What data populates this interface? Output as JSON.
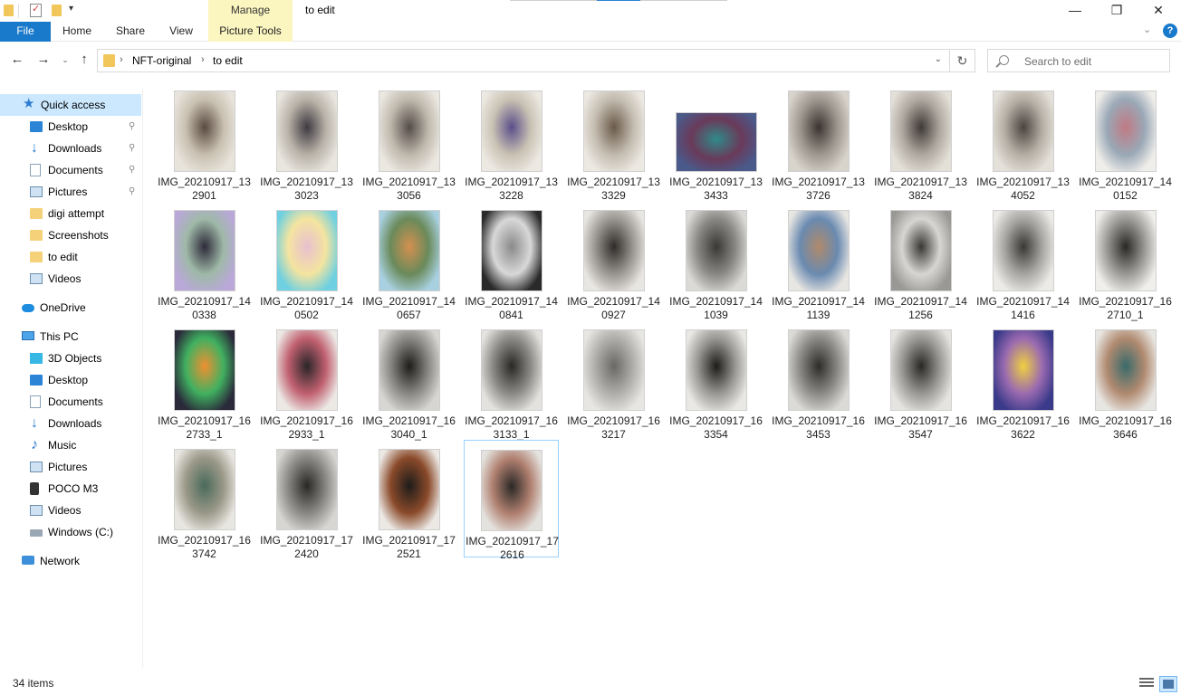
{
  "window": {
    "title": "to edit",
    "manage_label": "Manage",
    "min_icon": "—",
    "max_icon": "❐",
    "close_icon": "✕"
  },
  "ribbon": {
    "file": "File",
    "home": "Home",
    "share": "Share",
    "view": "View",
    "picture_tools": "Picture Tools",
    "expand_icon": "⌄",
    "help_icon": "?"
  },
  "nav": {
    "back_icon": "←",
    "forward_icon": "→",
    "recent_icon": "⌄",
    "up_icon": "↑",
    "breadcrumb": [
      "NFT-original",
      "to edit"
    ],
    "sep": "›",
    "dropdown_icon": "⌄",
    "refresh_icon": "↻",
    "search_placeholder": "Search to edit"
  },
  "sidebar": {
    "quick_access": "Quick access",
    "quick_items": [
      {
        "label": "Desktop",
        "pinned": true
      },
      {
        "label": "Downloads",
        "pinned": true
      },
      {
        "label": "Documents",
        "pinned": true
      },
      {
        "label": "Pictures",
        "pinned": true
      },
      {
        "label": "digi attempt",
        "pinned": false
      },
      {
        "label": "Screenshots",
        "pinned": false
      },
      {
        "label": "to edit",
        "pinned": false
      },
      {
        "label": "Videos",
        "pinned": false
      }
    ],
    "pin_icon": "📌",
    "onedrive": "OneDrive",
    "this_pc": "This PC",
    "pc_items": [
      "3D Objects",
      "Desktop",
      "Documents",
      "Downloads",
      "Music",
      "Pictures",
      "POCO M3",
      "Videos",
      "Windows (C:)"
    ],
    "network": "Network"
  },
  "files": [
    {
      "line1": "IMG_20210917_13",
      "line2": "2901",
      "colors": [
        "#e8e4dc",
        "#5a4a40",
        "#c8bfb0"
      ]
    },
    {
      "line1": "IMG_20210917_13",
      "line2": "3023",
      "colors": [
        "#e9e6df",
        "#3e3a40",
        "#b8b2a8"
      ]
    },
    {
      "line1": "IMG_20210917_13",
      "line2": "3056",
      "colors": [
        "#ebe8e1",
        "#554c48",
        "#bfb8ac"
      ]
    },
    {
      "line1": "IMG_20210917_13",
      "line2": "3228",
      "colors": [
        "#ece9e2",
        "#5a4f8a",
        "#c9c1b3"
      ]
    },
    {
      "line1": "IMG_20210917_13",
      "line2": "3329",
      "colors": [
        "#ece9e2",
        "#6a5a4a",
        "#c2baae"
      ]
    },
    {
      "line1": "IMG_20210917_13",
      "line2": "3433",
      "colors": [
        "#4a5a8a",
        "#2f8a8a",
        "#6a3a5a"
      ],
      "wide": true
    },
    {
      "line1": "IMG_20210917_13",
      "line2": "3726",
      "colors": [
        "#d8d4cc",
        "#3a3430",
        "#a09890"
      ]
    },
    {
      "line1": "IMG_20210917_13",
      "line2": "3824",
      "colors": [
        "#e3e0d8",
        "#3f3a36",
        "#b0a8a0"
      ]
    },
    {
      "line1": "IMG_20210917_13",
      "line2": "4052",
      "colors": [
        "#e4e1da",
        "#4a4440",
        "#b6aea4"
      ]
    },
    {
      "line1": "IMG_20210917_14",
      "line2": "0152",
      "colors": [
        "#f0eeea",
        "#c07a84",
        "#9aa8b6"
      ]
    },
    {
      "line1": "IMG_20210917_14",
      "line2": "0338",
      "colors": [
        "#b9a8d8",
        "#2e2a3a",
        "#9fb9a8"
      ]
    },
    {
      "line1": "IMG_20210917_14",
      "line2": "0502",
      "colors": [
        "#6ed0e0",
        "#e8c0d0",
        "#f4e4a0"
      ]
    },
    {
      "line1": "IMG_20210917_14",
      "line2": "0657",
      "colors": [
        "#a8d0e0",
        "#d49050",
        "#6a8a5a"
      ]
    },
    {
      "line1": "IMG_20210917_14",
      "line2": "0841",
      "colors": [
        "#2a2a2a",
        "#8a8a8a",
        "#d8d8d8"
      ]
    },
    {
      "line1": "IMG_20210917_14",
      "line2": "0927",
      "colors": [
        "#e8e6e2",
        "#2e2c2a",
        "#9a9690"
      ]
    },
    {
      "line1": "IMG_20210917_14",
      "line2": "1039",
      "colors": [
        "#dcdad6",
        "#3a3836",
        "#8a8884"
      ]
    },
    {
      "line1": "IMG_20210917_14",
      "line2": "1139",
      "colors": [
        "#e8e6e2",
        "#b08a6a",
        "#6a8ab0"
      ]
    },
    {
      "line1": "IMG_20210917_14",
      "line2": "1256",
      "colors": [
        "#9a9894",
        "#3a3836",
        "#d8d6d2"
      ]
    },
    {
      "line1": "IMG_20210917_14",
      "line2": "1416",
      "colors": [
        "#ecebe8",
        "#3a3836",
        "#a8a6a2"
      ]
    },
    {
      "line1": "IMG_20210917_16",
      "line2": "2710_1",
      "colors": [
        "#f0efec",
        "#2a2826",
        "#9c9a96"
      ]
    },
    {
      "line1": "IMG_20210917_16",
      "line2": "2733_1",
      "colors": [
        "#2a2a3a",
        "#f09030",
        "#40b060"
      ]
    },
    {
      "line1": "IMG_20210917_16",
      "line2": "2933_1",
      "colors": [
        "#ece8e4",
        "#2a2628",
        "#c06070"
      ]
    },
    {
      "line1": "IMG_20210917_16",
      "line2": "3040_1",
      "colors": [
        "#d8d6d2",
        "#1e1c1a",
        "#8a8884"
      ]
    },
    {
      "line1": "IMG_20210917_16",
      "line2": "3133_1",
      "colors": [
        "#e4e2de",
        "#2a2826",
        "#8c8a86"
      ]
    },
    {
      "line1": "IMG_20210917_16",
      "line2": "3217",
      "colors": [
        "#e8e6e2",
        "#6a6864",
        "#b0aeaa"
      ]
    },
    {
      "line1": "IMG_20210917_16",
      "line2": "3354",
      "colors": [
        "#eae8e4",
        "#1e1c1a",
        "#9a9894"
      ]
    },
    {
      "line1": "IMG_20210917_16",
      "line2": "3453",
      "colors": [
        "#dcdad6",
        "#2e2c2a",
        "#8c8a86"
      ]
    },
    {
      "line1": "IMG_20210917_16",
      "line2": "3547",
      "colors": [
        "#e6e4e0",
        "#2a2826",
        "#9a9894"
      ]
    },
    {
      "line1": "IMG_20210917_16",
      "line2": "3622",
      "colors": [
        "#3a3a8a",
        "#f0d040",
        "#9a6ab0"
      ]
    },
    {
      "line1": "IMG_20210917_16",
      "line2": "3646",
      "colors": [
        "#e8e6e2",
        "#3a6a6a",
        "#b08a70"
      ]
    },
    {
      "line1": "IMG_20210917_16",
      "line2": "3742",
      "colors": [
        "#e8e6e0",
        "#4a6a5a",
        "#9a9888"
      ]
    },
    {
      "line1": "IMG_20210917_17",
      "line2": "2420",
      "colors": [
        "#d8d6d2",
        "#2a2826",
        "#8a8884"
      ]
    },
    {
      "line1": "IMG_20210917_17",
      "line2": "2521",
      "colors": [
        "#ece8e4",
        "#1e1c1a",
        "#8a4a2a"
      ]
    },
    {
      "line1": "IMG_20210917_17",
      "line2": "2616",
      "colors": [
        "#e4e2de",
        "#2a2826",
        "#b08070"
      ],
      "selected": true
    }
  ],
  "status": {
    "count": "34 items"
  }
}
